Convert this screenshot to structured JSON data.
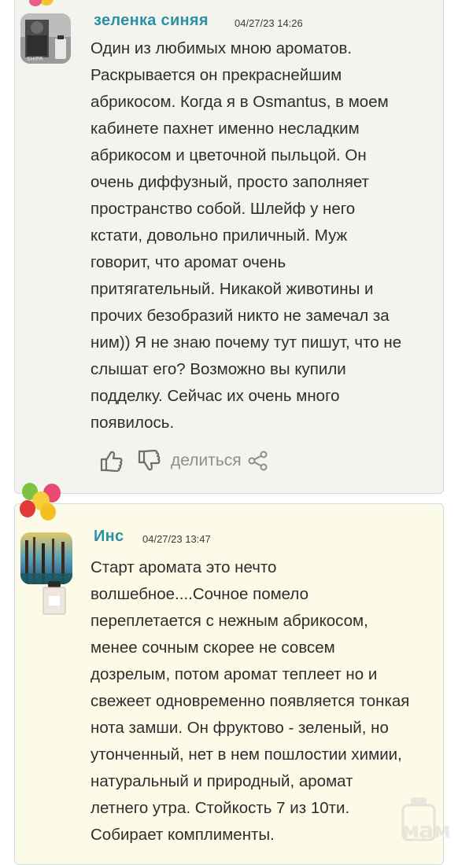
{
  "comments": [
    {
      "author": "зеленка синяя",
      "date": "04/27/23 14:26",
      "avatar_caption": "SHIPR",
      "lines": [
        "Один из любимых мною ароматов.",
        "Раскрывается он прекраснейшим",
        "абрикосом. Когда я в Osmantus, в моем",
        "кабинете пахнет именно несладким",
        "абрикосом и цветочной пыльцой. Он",
        "очень диффузный, просто заполняет",
        "пространство собой. Шлейф у него",
        "кстати, довольно приличный. Муж",
        "говорит, что аромат очень",
        "притягательный. Никакой животины и",
        "прочих безобразий никто не замечал за",
        "ним)) Я не знаю почему тут пишут, что не",
        "слышат его? Возможно вы купили",
        "подделку. Сейчас их очень много",
        "появилось."
      ],
      "actions": {
        "like_icon": "thumbs-up-icon",
        "dislike_icon": "thumbs-down-icon",
        "share_label": "делиться",
        "share_icon": "share-icon"
      }
    },
    {
      "author": "Инс",
      "date": "04/27/23 13:47",
      "lines": [
        "Старт аромата это нечто",
        "волшебное....Сочное помело",
        "переплетается с нежным абрикосом,",
        "менее сочным скорее не совсем",
        "дозрелым, потом аромат теплеет но и",
        "свежеет одновременно появляется тонкая",
        "нота замши. Он фруктово - зеленый, но",
        "утонченный, нет в нем пошлостии химии,",
        "натуральный и природный, аромат",
        "летнего утра. Стойкость 7 из 10ти.",
        "Собирает комплименты."
      ]
    }
  ],
  "watermark": "мам",
  "colors": {
    "author": "#2c8fa6",
    "card1_bg": "#f3f4ee",
    "card2_bg": "#fcfbe8",
    "card_border": "#ccdde4",
    "muted": "#8e8e8e"
  }
}
